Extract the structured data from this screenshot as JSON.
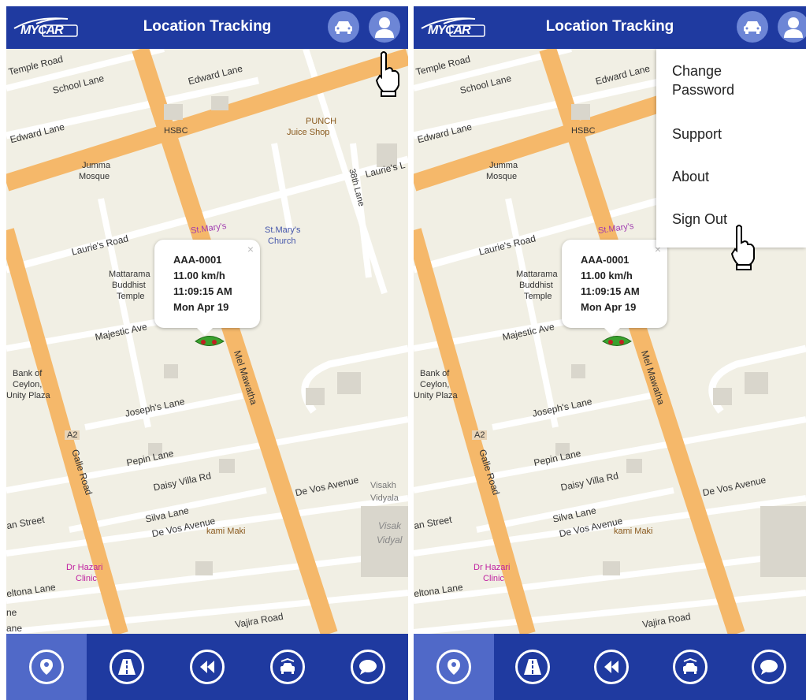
{
  "app": {
    "logo_text": "MYCAR",
    "title": "Location Tracking"
  },
  "map": {
    "labels": {
      "temple_road": "Temple Road",
      "school_lane": "School Lane",
      "edward_lane_top": "Edward Lane",
      "edward_lane": "Edward Lane",
      "hsbc": "HSBC",
      "punch": "PUNCH",
      "juice_shop": "Juice Shop",
      "jumma": "Jumma",
      "mosque": "Mosque",
      "lane_38": "38th Lane",
      "lauries_road": "Laurie's Road",
      "lauries_short": "Laurie's L",
      "st_marys": "St.Mary's",
      "church": "Church",
      "st_marys_church": "St.Mary's",
      "mattarama": "Mattarama",
      "buddhist": "Buddhist",
      "temple": "Temple",
      "majestic": "Majestic Ave",
      "mel_mawatha": "Mel Mawatha",
      "bank_of": "Bank of",
      "ceylon": "Ceylon,",
      "unity_plaza": "Unity Plaza",
      "josephs": "Joseph's Lane",
      "a2": "A2",
      "galle_road": "Galle Road",
      "pepin": "Pepin Lane",
      "daisy": "Daisy Villa Rd",
      "de_vos": "De Vos Avenue",
      "de_vos_2": "De Vos Avenue",
      "visakha1": "Visakh",
      "vidyala": "Vidyala",
      "visakha2": "Visak",
      "vidyal2": "Vidyal",
      "silva": "Silva Lane",
      "an_street": "an Street",
      "kami_maki": "kami Maki",
      "dr_hazari": "Dr Hazari",
      "clinic": "Clinic",
      "deltona": "eltona Lane",
      "vajira": "Vajira Road",
      "ne": "ne",
      "ane": "ane"
    }
  },
  "popup": {
    "plate": "AAA-0001",
    "speed": "11.00 km/h",
    "time": "11:09:15 AM",
    "date": "Mon Apr 19",
    "close": "×"
  },
  "menu": {
    "change_password_1": "Change",
    "change_password_2": "Password",
    "support": "Support",
    "about": "About",
    "sign_out": "Sign Out"
  },
  "nav_icons": [
    "location-icon",
    "road-icon",
    "rewind-icon",
    "car-service-icon",
    "chat-icon"
  ],
  "colors": {
    "header": "#1f3aa0",
    "active_tab": "#5069c8",
    "road_major": "#f5b86a",
    "map_bg": "#f1efe4"
  }
}
